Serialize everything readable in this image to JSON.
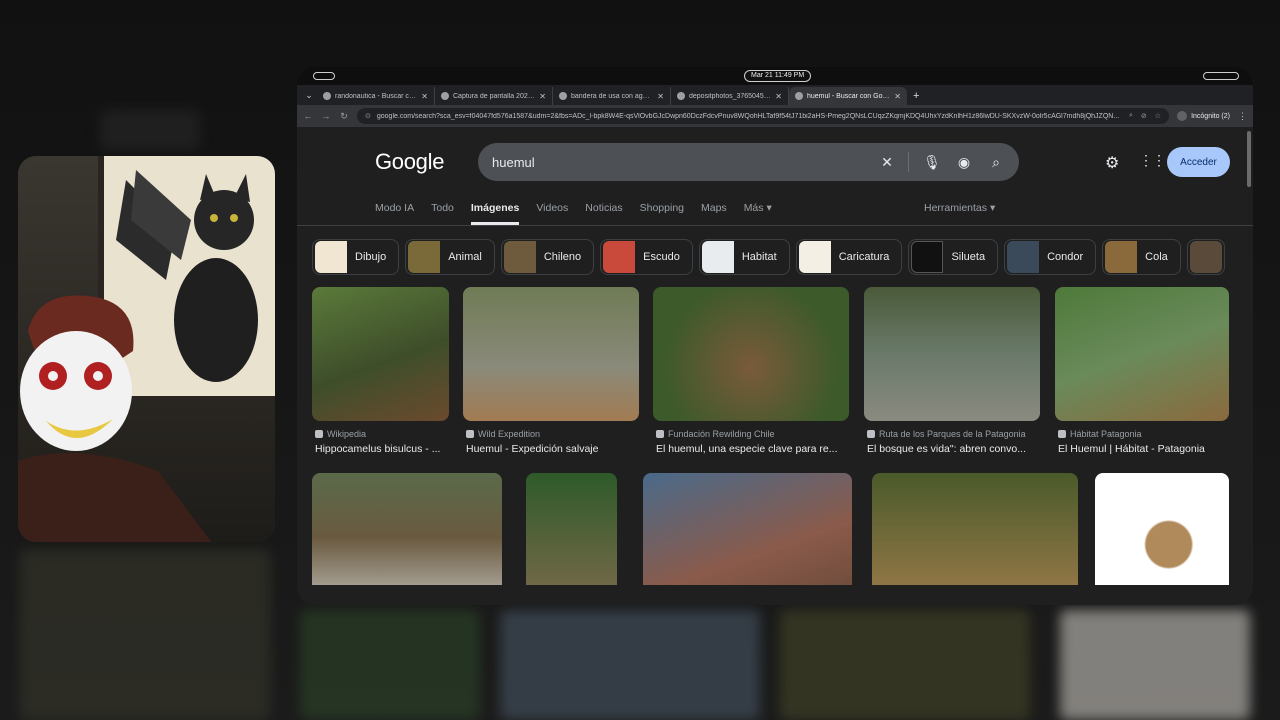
{
  "status_bar": {
    "clock": "Mar 21  11:49 PM"
  },
  "browser": {
    "tabs": [
      {
        "title": "randonautica - Buscar con G",
        "active": false
      },
      {
        "title": "Captura de pantalla 2021-09",
        "active": false
      },
      {
        "title": "bandera de usa con aguila - B",
        "active": false
      },
      {
        "title": "depositphotos_376504538-",
        "active": false
      },
      {
        "title": "huemul - Buscar con Google",
        "active": true
      }
    ],
    "new_tab": "+",
    "url": "google.com/search?sca_esv=f04047fd576a1587&udm=2&fbs=ADc_l-bpk8W4E-qsVlOvbGJcDwpn60DczFdcvPnuv8WQohHLTaf9f54tJ71bi2aHS-Pmeg2QNsLCUqzZKqmjKDQ4UhxYzdKnlhH1z86lwDU-SKXvzW-0olr5cAGl7mdh8jQhJZQN...",
    "incognito_label": "Incógnito (2)"
  },
  "google": {
    "logo": "Google",
    "query": "huemul",
    "signin": "Acceder",
    "nav_tabs": [
      {
        "label": "Modo IA",
        "active": false
      },
      {
        "label": "Todo",
        "active": false
      },
      {
        "label": "Imágenes",
        "active": true
      },
      {
        "label": "Videos",
        "active": false
      },
      {
        "label": "Noticias",
        "active": false
      },
      {
        "label": "Shopping",
        "active": false
      },
      {
        "label": "Maps",
        "active": false
      },
      {
        "label": "Más ▾",
        "active": false
      }
    ],
    "tools": "Herramientas ▾",
    "chips": [
      {
        "label": "Dibujo",
        "color": "#f0e6d2"
      },
      {
        "label": "Animal",
        "color": "#7a6a3a"
      },
      {
        "label": "Chileno",
        "color": "#6e5a3c"
      },
      {
        "label": "Escudo",
        "color": "#c94a3a"
      },
      {
        "label": "Habitat",
        "color": "#e8ecef"
      },
      {
        "label": "Caricatura",
        "color": "#f4efe4"
      },
      {
        "label": "Silueta",
        "color": "#111111"
      },
      {
        "label": "Condor",
        "color": "#3b4a5a"
      },
      {
        "label": "Cola",
        "color": "#8a6a3a"
      }
    ],
    "results_row1": [
      {
        "source": "Wikipedia",
        "title": "Hippocamelus bisulcus - ...",
        "colors": [
          "#5b7a3a",
          "#6b4a2e"
        ]
      },
      {
        "source": "Wild Expedition",
        "title": "Huemul - Expedición salvaje",
        "colors": [
          "#6f7b55",
          "#a27b52"
        ]
      },
      {
        "source": "Fundación Rewilding Chile",
        "title": "El huemul, una especie clave para re...",
        "colors": [
          "#3c5a2a",
          "#7a5a3a"
        ]
      },
      {
        "source": "Ruta de los Parques de la Patagonia",
        "title": "El bosque es vida\": abren convo...",
        "colors": [
          "#6a7a6a",
          "#8a8a80"
        ]
      },
      {
        "source": "Hábitat Patagonia",
        "title": "El Huemul | Hábitat - Patagonia",
        "colors": [
          "#4e7a3a",
          "#8a6a3e"
        ]
      }
    ],
    "results_row2": [
      {
        "colors": [
          "#6a5a40",
          "#b8b4ac"
        ]
      },
      {
        "colors": [
          "#2e5a2a",
          "#7a6a4a"
        ]
      },
      {
        "colors": [
          "#4a6a8a",
          "#8a5a4a"
        ]
      },
      {
        "colors": [
          "#4a5a2a",
          "#9a7a4a"
        ]
      },
      {
        "colors": [
          "#ffffff",
          "#b08a5a"
        ]
      }
    ]
  }
}
